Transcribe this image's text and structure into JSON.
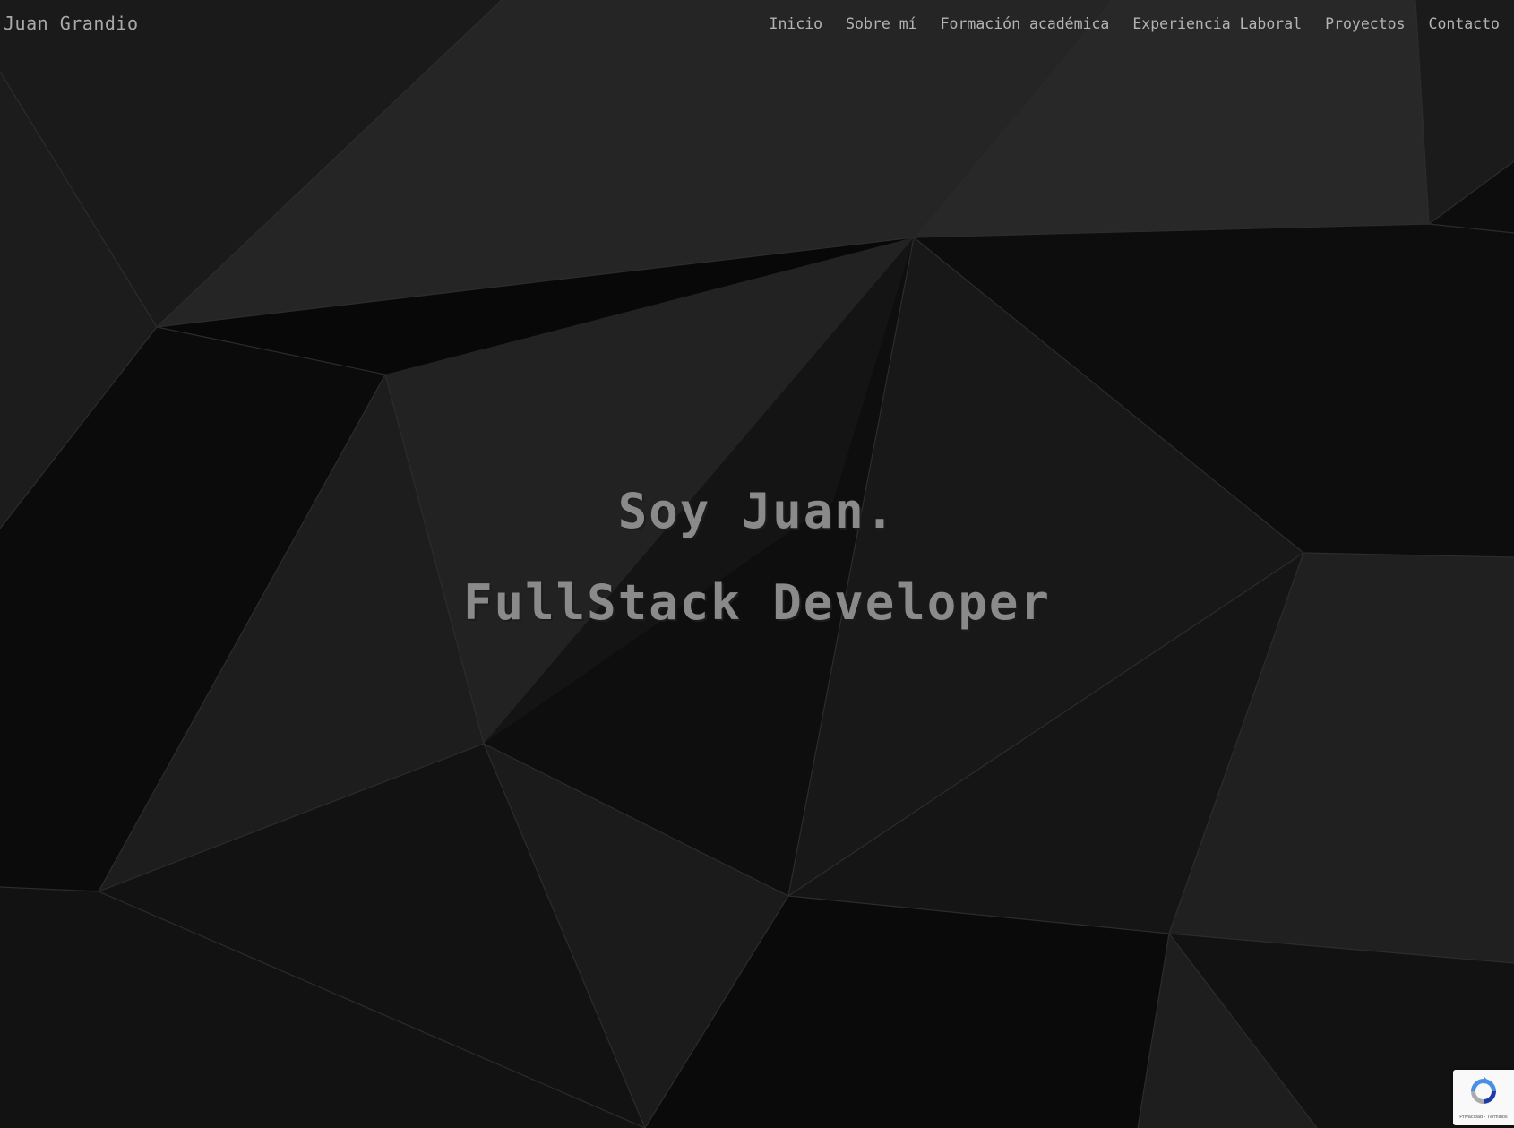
{
  "header": {
    "brand": "Juan Grandio",
    "nav": [
      {
        "label": "Inicio"
      },
      {
        "label": "Sobre mí"
      },
      {
        "label": "Formación académica"
      },
      {
        "label": "Experiencia Laboral"
      },
      {
        "label": "Proyectos"
      },
      {
        "label": "Contacto"
      }
    ]
  },
  "hero": {
    "line1": "Soy Juan.",
    "line2": "FullStack Developer"
  },
  "recaptcha": {
    "terms": "Privacidad - Términos"
  },
  "colors": {
    "background": "#111111",
    "text": "#a9a9a9",
    "hero_text": "#8a8a8a"
  }
}
